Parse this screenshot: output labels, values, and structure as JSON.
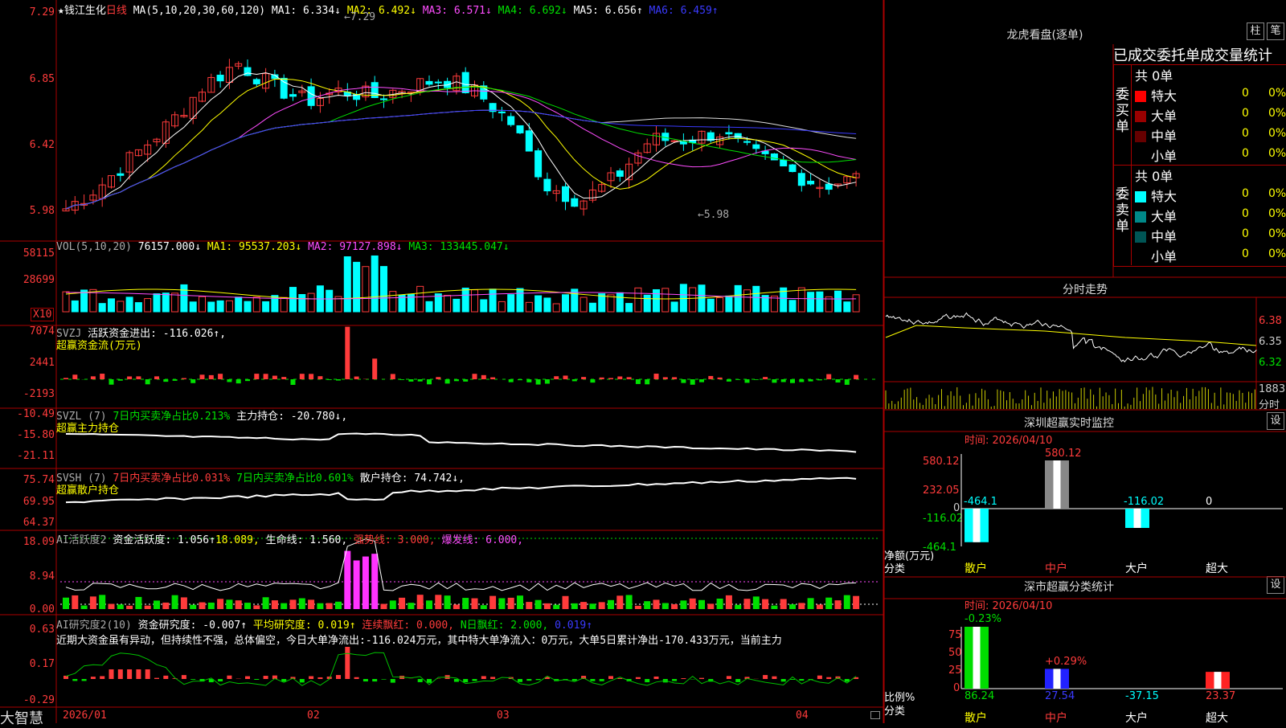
{
  "stock": {
    "star": "★",
    "name": "钱江生化",
    "period": "日线"
  },
  "ma_header": {
    "label": "MA(5,10,20,30,60,120)",
    "ma1": "MA1: 6.334↓",
    "ma2": "MA2: 6.492↓",
    "ma3": "MA3: 6.571↓",
    "ma4": "MA4: 6.692↓",
    "ma5": "MA5: 6.656↑",
    "ma6": "MA6: 6.459↑"
  },
  "price_axis": [
    "7.29",
    "6.85",
    "6.42",
    "5.98"
  ],
  "price_notes": {
    "high": "←7.29",
    "low": "←5.98"
  },
  "vol": {
    "label": "VOL(5,10,20)",
    "v": "76157.000↓",
    "ma1": "MA1: 95537.203↓",
    "ma2": "MA2: 97127.898↓",
    "ma3": "MA3: 133445.047↓",
    "axis": [
      "58115",
      "28699"
    ],
    "unit": "X10"
  },
  "svzj": {
    "label": "SVZJ",
    "text": "活跃资金进出: -116.026↑,",
    "sub": "超赢资金流(万元)",
    "axis": [
      "7074",
      "2441",
      "-2193"
    ]
  },
  "svzl": {
    "label": "SVZL (7)",
    "text1": "7日内买卖净占比0.213%",
    "text2": "主力持仓: -20.780↓,",
    "sub": "超赢主力持仓",
    "axis": [
      "-10.49",
      "-15.80",
      "-21.11"
    ]
  },
  "svsh": {
    "label": "SVSH (7)",
    "text1": "7日内买卖净占比0.031%",
    "text2": "7日内买卖净占比0.601%",
    "text3": "散户持仓: 74.742↓,",
    "sub": "超赢散户持仓",
    "axis": [
      "75.74",
      "69.95",
      "64.37"
    ]
  },
  "ai1": {
    "label": "AI活跃度2",
    "t1": "资金活跃度: 1.056↑",
    "t2": "18.089,",
    "t3": "生命线: 1.560,",
    "t4": "强势线: 3.000,",
    "t5": "爆发线: 6.000,",
    "axis": [
      "18.09",
      "8.94",
      "0.00"
    ]
  },
  "ai2": {
    "label": "AI研究度2(10)",
    "t1": "资金研究度: -0.007↑",
    "t2": "平均研究度: 0.019↑",
    "t3": "连续飘红: 0.000,",
    "t4": "N日飘红: 2.000,",
    "t5": "0.019↑",
    "axis": [
      "0.63",
      "0.17",
      "-0.29"
    ],
    "comment": "近期大资金虽有异动，但持续性不强，总体偏空，今日大单净流出:-116.024万元，其中特大单净流入：0万元，大单5日累计净出-170.433万元，当前主力"
  },
  "date_axis": [
    "2026/01",
    "02",
    "03",
    "04"
  ],
  "brand": "大智慧",
  "right": {
    "lhkp": {
      "title": "龙虎看盘(逐单)",
      "btn1": "柱",
      "btn2": "笔",
      "subtitle": "已成交委托单成交量统计"
    },
    "buy": {
      "side": "委买单",
      "total": "共 0单",
      "rows": [
        {
          "name": "特大",
          "count": "0",
          "pct": "0%",
          "color": "#ff0000"
        },
        {
          "name": "大单",
          "count": "0",
          "pct": "0%",
          "color": "#990000"
        },
        {
          "name": "中单",
          "count": "0",
          "pct": "0%",
          "color": "#660000"
        },
        {
          "name": "小单",
          "count": "0",
          "pct": "0%",
          "color": "#000000"
        }
      ]
    },
    "sell": {
      "side": "委卖单",
      "total": "共 0单",
      "rows": [
        {
          "name": "特大",
          "count": "0",
          "pct": "0%",
          "color": "#00ffff"
        },
        {
          "name": "大单",
          "count": "0",
          "pct": "0%",
          "color": "#008888"
        },
        {
          "name": "中单",
          "count": "0",
          "pct": "0%",
          "color": "#005555"
        },
        {
          "name": "小单",
          "count": "0",
          "pct": "0%",
          "color": "#000000"
        }
      ]
    },
    "fenshi": {
      "title": "分时走势",
      "axis": [
        "6.38",
        "6.35",
        "6.32"
      ],
      "vol_label": "1883",
      "vol_unit": "分时"
    },
    "szcy": {
      "title": "深圳超赢实时监控",
      "btn": "设",
      "time": "时间: 2026/04/10",
      "axis": [
        "580.12",
        "232.05",
        "0",
        "-116.02",
        "-464.1"
      ],
      "y_label": "净额(万元)",
      "x_label": "分类",
      "bars": [
        {
          "cat": "散户",
          "value": -464.1,
          "label": "-464.1"
        },
        {
          "cat": "中户",
          "value": 580.12,
          "label": "580.12"
        },
        {
          "cat": "大户",
          "value": -116.02,
          "label": "-116.02"
        },
        {
          "cat": "超大",
          "value": 0,
          "label": "0"
        }
      ]
    },
    "sscy": {
      "title": "深市超赢分类统计",
      "btn": "设",
      "time": "时间: 2026/04/10",
      "axis": [
        "75",
        "50",
        "25",
        "0"
      ],
      "y_label": "比例%",
      "x_label": "分类",
      "bars": [
        {
          "cat": "散户",
          "value": 86.24,
          "top": "-0.23%"
        },
        {
          "cat": "中户",
          "value": 27.54,
          "top": "+0.29%"
        },
        {
          "cat": "大户",
          "value": -37.15,
          "top": ""
        },
        {
          "cat": "超大",
          "value": 23.37,
          "top": ""
        }
      ],
      "values": [
        "86.24",
        "27.54",
        "-37.15",
        "23.37"
      ]
    }
  },
  "colors": {
    "up": "#ff3b3b",
    "down": "#00ffff",
    "frame": "#aa0000"
  }
}
